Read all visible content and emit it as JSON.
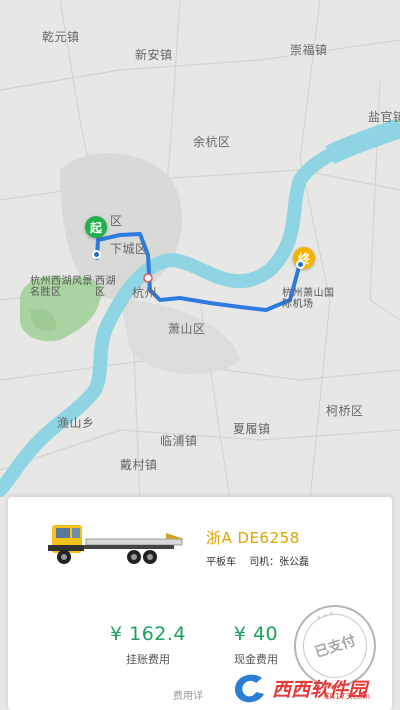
{
  "map": {
    "places": [
      {
        "name": "乾元镇"
      },
      {
        "name": "新安镇"
      },
      {
        "name": "崇福镇"
      },
      {
        "name": "盐官镇"
      },
      {
        "name": "余杭区"
      },
      {
        "name": "区"
      },
      {
        "name": "下城区"
      },
      {
        "name": "杭州西湖风景名胜区"
      },
      {
        "name": "西湖区"
      },
      {
        "name": "杭州"
      },
      {
        "name": "萧山区"
      },
      {
        "name": "杭州萧山国际机场"
      },
      {
        "name": "渔山乡"
      },
      {
        "name": "临浦镇"
      },
      {
        "name": "夏履镇"
      },
      {
        "name": "戴村镇"
      },
      {
        "name": "柯桥区"
      }
    ],
    "start_label": "起",
    "end_label": "终",
    "colors": {
      "route": "#2e7be0",
      "river": "#8fd4e3",
      "start": "#21b04b",
      "end": "#f5b200"
    }
  },
  "order": {
    "plate": "浙A DE6258",
    "vehicle_type": "平板车",
    "driver": "司机：张公磊",
    "fees": [
      {
        "amount": "¥ 162.4",
        "label": "挂账费用"
      },
      {
        "amount": "¥ 40",
        "label": "现金费用"
      }
    ],
    "fee_detail_link": "费用详",
    "status_stamp": "已支付",
    "stamp_stars": "* * *"
  },
  "watermark": {
    "text": "西西软件园",
    "url": "CR173.com"
  }
}
